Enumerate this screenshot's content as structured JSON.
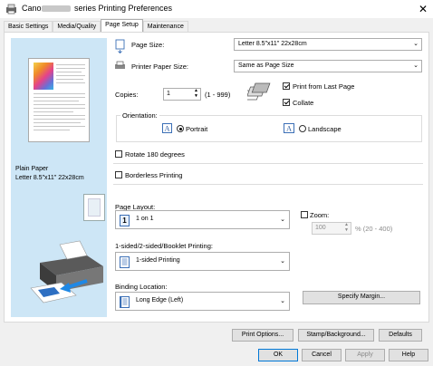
{
  "window": {
    "title_prefix": "Canon",
    "title_suffix": "series Printing Preferences",
    "close_glyph": "✕"
  },
  "tabs": [
    {
      "label": "Basic Settings",
      "active": false
    },
    {
      "label": "Media/Quality",
      "active": false
    },
    {
      "label": "Page Setup",
      "active": true
    },
    {
      "label": "Maintenance",
      "active": false
    }
  ],
  "preview": {
    "media_type": "Plain Paper",
    "paper_desc": "Letter 8.5\"x11\" 22x28cm"
  },
  "page_size": {
    "label": "Page Size:",
    "value": "Letter 8.5\"x11\" 22x28cm"
  },
  "printer_paper_size": {
    "label": "Printer Paper Size:",
    "value": "Same as Page Size"
  },
  "copies": {
    "label": "Copies:",
    "value": "1",
    "range": "(1 - 999)"
  },
  "print_from_last_page": {
    "label": "Print from Last Page",
    "checked": true
  },
  "collate": {
    "label": "Collate",
    "checked": true
  },
  "orientation": {
    "label": "Orientation:",
    "portrait": {
      "label": "Portrait",
      "selected": true
    },
    "landscape": {
      "label": "Landscape",
      "selected": false
    }
  },
  "rotate_180": {
    "label": "Rotate 180 degrees",
    "checked": false
  },
  "borderless": {
    "label": "Borderless Printing",
    "checked": false
  },
  "page_layout": {
    "label": "Page Layout:",
    "value": "1 on 1",
    "icon_text": "1"
  },
  "zoom": {
    "label": "Zoom:",
    "checked": false,
    "value": "100",
    "range": "% (20 - 400)"
  },
  "sided_printing": {
    "label": "1-sided/2-sided/Booklet Printing:",
    "value": "1-sided Printing"
  },
  "binding_location": {
    "label": "Binding Location:",
    "value": "Long Edge (Left)"
  },
  "buttons": {
    "specify_margin": "Specify Margin...",
    "print_options": "Print Options...",
    "stamp_background": "Stamp/Background...",
    "defaults": "Defaults",
    "ok": "OK",
    "cancel": "Cancel",
    "apply": "Apply",
    "help": "Help"
  },
  "icon_names": {
    "dropdown": "chevron-down-icon",
    "page_size": "page-size-icon",
    "printer_paper": "printer-paper-icon",
    "copies": "stacked-copies-icon",
    "orientation_portrait": "portrait-letter-a-icon",
    "orientation_landscape": "landscape-letter-a-icon"
  },
  "colors": {
    "preview_bg": "#cde6f6",
    "primary_border": "#0078d7"
  }
}
